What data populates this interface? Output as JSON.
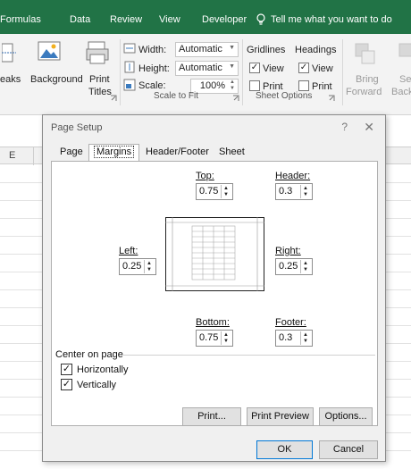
{
  "ribbon_tabs": [
    "Formulas",
    "Data",
    "Review",
    "View",
    "Developer"
  ],
  "tell_me": "Tell me what you want to do",
  "ribbon": {
    "breaks": "eaks",
    "background": "Background",
    "print_titles_1": "Print",
    "print_titles_2": "Titles",
    "width_label": "Width:",
    "width_value": "Automatic",
    "height_label": "Height:",
    "height_value": "Automatic",
    "scale_label": "Scale:",
    "scale_value": "100%",
    "scale_group": "Scale to Fit",
    "gridlines": "Gridlines",
    "headings": "Headings",
    "gridlines_view": "View",
    "gridlines_print": "Print",
    "headings_view": "View",
    "headings_print": "Print",
    "sheet_options": "Sheet Options",
    "bring_forward_1": "Bring",
    "bring_forward_2": "Forward",
    "send_backward_1": "Se",
    "send_backward_2": "Backv"
  },
  "column_header": "E",
  "dialog": {
    "title": "Page Setup",
    "help": "?",
    "close": "✕",
    "tabs": [
      "Page",
      "Margins",
      "Header/Footer",
      "Sheet"
    ],
    "active_tab": "Margins",
    "margins": {
      "top": {
        "label": "Top:",
        "value": "0.75"
      },
      "header": {
        "label": "Header:",
        "value": "0.3"
      },
      "left": {
        "label": "Left:",
        "value": "0.25"
      },
      "right": {
        "label": "Right:",
        "value": "0.25"
      },
      "bottom": {
        "label": "Bottom:",
        "value": "0.75"
      },
      "footer": {
        "label": "Footer:",
        "value": "0.3"
      }
    },
    "center_on_page": "Center on page",
    "horizontally": "Horizontally",
    "vertically": "Vertically",
    "horizontally_checked": true,
    "vertically_checked": true,
    "buttons": {
      "print": "Print...",
      "print_preview": "Print Preview",
      "options": "Options...",
      "ok": "OK",
      "cancel": "Cancel"
    }
  },
  "colors": {
    "excel_green": "#217346",
    "ok_border": "#0078d7"
  }
}
